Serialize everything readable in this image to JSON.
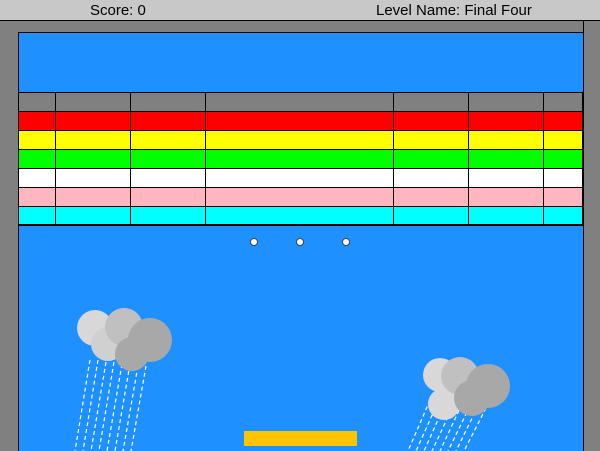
{
  "hud": {
    "score_label": "Score: 0",
    "level_label": "Level Name: Final Four"
  },
  "colors": {
    "background": "#1e90ff",
    "wall": "#808080",
    "paddle": "#ffc400",
    "ball": "#ffffff"
  },
  "brick_rows": [
    {
      "color": "gray",
      "hex": "#808080"
    },
    {
      "color": "red",
      "hex": "#ff0000"
    },
    {
      "color": "yellow",
      "hex": "#ffff00"
    },
    {
      "color": "green",
      "hex": "#00ff00"
    },
    {
      "color": "white",
      "hex": "#ffffff"
    },
    {
      "color": "pink",
      "hex": "#ffb6c1"
    },
    {
      "color": "cyan",
      "hex": "#00ffff"
    }
  ],
  "brick_columns": 7,
  "balls": 3,
  "clouds": 2
}
